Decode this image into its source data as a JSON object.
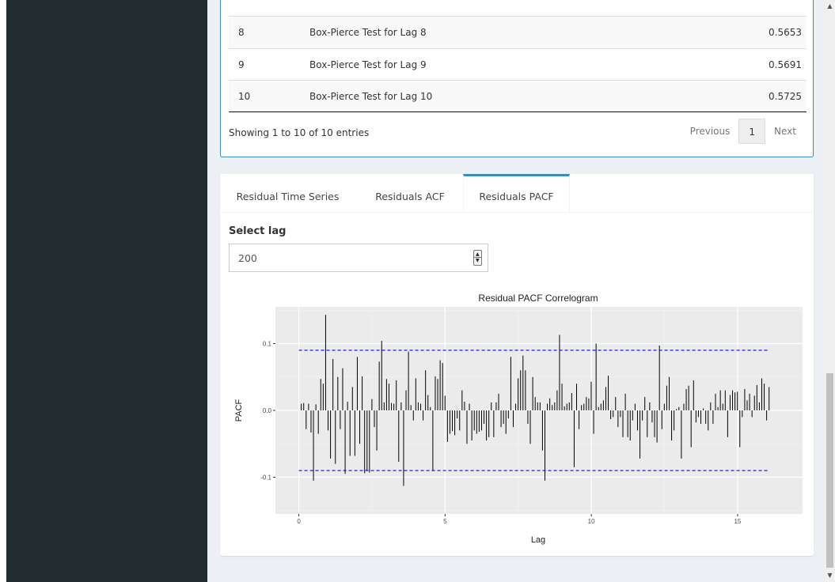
{
  "table": {
    "rows": [
      {
        "lag": "8",
        "test": "Box-Pierce Test for Lag 8",
        "pvalue": "0.5653"
      },
      {
        "lag": "9",
        "test": "Box-Pierce Test for Lag 9",
        "pvalue": "0.5691"
      },
      {
        "lag": "10",
        "test": "Box-Pierce Test for Lag 10",
        "pvalue": "0.5725"
      }
    ],
    "info": "Showing 1 to 10 of 10 entries",
    "pagination": {
      "previous": "Previous",
      "current": "1",
      "next": "Next"
    }
  },
  "tabs": [
    {
      "label": "Residual Time Series",
      "active": false
    },
    {
      "label": "Residuals ACF",
      "active": false
    },
    {
      "label": "Residuals PACF",
      "active": true
    }
  ],
  "lag_input": {
    "label": "Select lag",
    "value": "200"
  },
  "colors": {
    "sidebar": "#222d32",
    "accent": "#3c8dbc",
    "conf_line": "#0000ff",
    "panel": "#ebebeb",
    "bar": "#000000"
  },
  "icons": {
    "spinner_up": "triangle-up-icon",
    "spinner_down": "triangle-down-icon"
  },
  "chart_data": {
    "type": "bar",
    "title": "Residual PACF Correlogram",
    "xlabel": "Lag",
    "ylabel": "PACF",
    "xlim": [
      -0.8,
      17.6
    ],
    "ylim": [
      -0.155,
      0.155
    ],
    "x_ticks": [
      0,
      5,
      10,
      15
    ],
    "x_tick_labels": [
      "0",
      "5",
      "10",
      "15"
    ],
    "y_ticks": [
      -0.1,
      0.0,
      0.1
    ],
    "y_tick_labels": [
      "-0.1",
      "0.0",
      "0.1"
    ],
    "grid": true,
    "confidence_bounds": [
      0.09,
      -0.09
    ],
    "lag_step": 0.0833,
    "values": [
      0.01,
      0.011,
      -0.028,
      0.01,
      -0.033,
      -0.105,
      0.009,
      -0.035,
      0.047,
      0.04,
      0.143,
      -0.03,
      -0.072,
      0.077,
      -0.08,
      0.05,
      -0.028,
      0.063,
      -0.095,
      0.013,
      -0.068,
      0.035,
      -0.068,
      0.08,
      -0.05,
      0.051,
      -0.094,
      -0.09,
      -0.093,
      0.017,
      -0.025,
      -0.06,
      0.073,
      0.104,
      0.012,
      0.047,
      0.04,
      0.011,
      0.01,
      0.045,
      -0.077,
      0.012,
      -0.113,
      0.03,
      0.088,
      0.008,
      -0.015,
      0.048,
      0.012,
      0.01,
      -0.015,
      0.06,
      0.023,
      0.005,
      -0.09,
      0.051,
      0.047,
      0.075,
      0.071,
      0.022,
      -0.047,
      -0.035,
      -0.031,
      -0.037,
      -0.012,
      -0.03,
      0.03,
      0.013,
      -0.05,
      0.01,
      -0.045,
      -0.03,
      -0.035,
      -0.032,
      -0.03,
      -0.02,
      -0.045,
      -0.04,
      0.012,
      -0.04,
      0.012,
      0.025,
      -0.025,
      -0.02,
      -0.035,
      -0.012,
      0.08,
      -0.025,
      0.01,
      0.048,
      0.06,
      0.082,
      0.06,
      -0.02,
      -0.05,
      0.05,
      0.02,
      0.012,
      0.012,
      -0.06,
      -0.105,
      0.01,
      0.018,
      0.008,
      0.012,
      0.03,
      0.113,
      0.04,
      0.006,
      0.01,
      0.012,
      0.026,
      -0.085,
      0.04,
      -0.028,
      0.008,
      0.01,
      0.02,
      0.018,
      0.043,
      -0.035,
      0.1,
      0.005,
      0.01,
      0.015,
      0.035,
      0.052,
      -0.013,
      -0.01,
      0.02,
      -0.025,
      -0.01,
      -0.04,
      0.025,
      -0.04,
      -0.045,
      -0.015,
      0.01,
      -0.03,
      -0.072,
      -0.015,
      0.02,
      -0.04,
      0.012,
      -0.018,
      -0.04,
      -0.048,
      0.097,
      -0.028,
      0.01,
      0.037,
      0.05,
      -0.045,
      -0.03,
      0.002,
      0.005,
      -0.072,
      0.01,
      0.032,
      0.037,
      -0.055,
      0.045,
      -0.018,
      -0.01,
      -0.02,
      0.003,
      -0.02,
      -0.03,
      0.012,
      -0.02,
      0.025,
      0.005,
      0.03,
      0.01,
      0.03,
      -0.04,
      0.023,
      0.03,
      0.027,
      0.028,
      -0.055,
      -0.01,
      0.032,
      0.015,
      0.025,
      -0.01,
      0.022,
      0.038,
      0.012,
      0.048,
      0.04,
      -0.015,
      0.035
    ]
  }
}
